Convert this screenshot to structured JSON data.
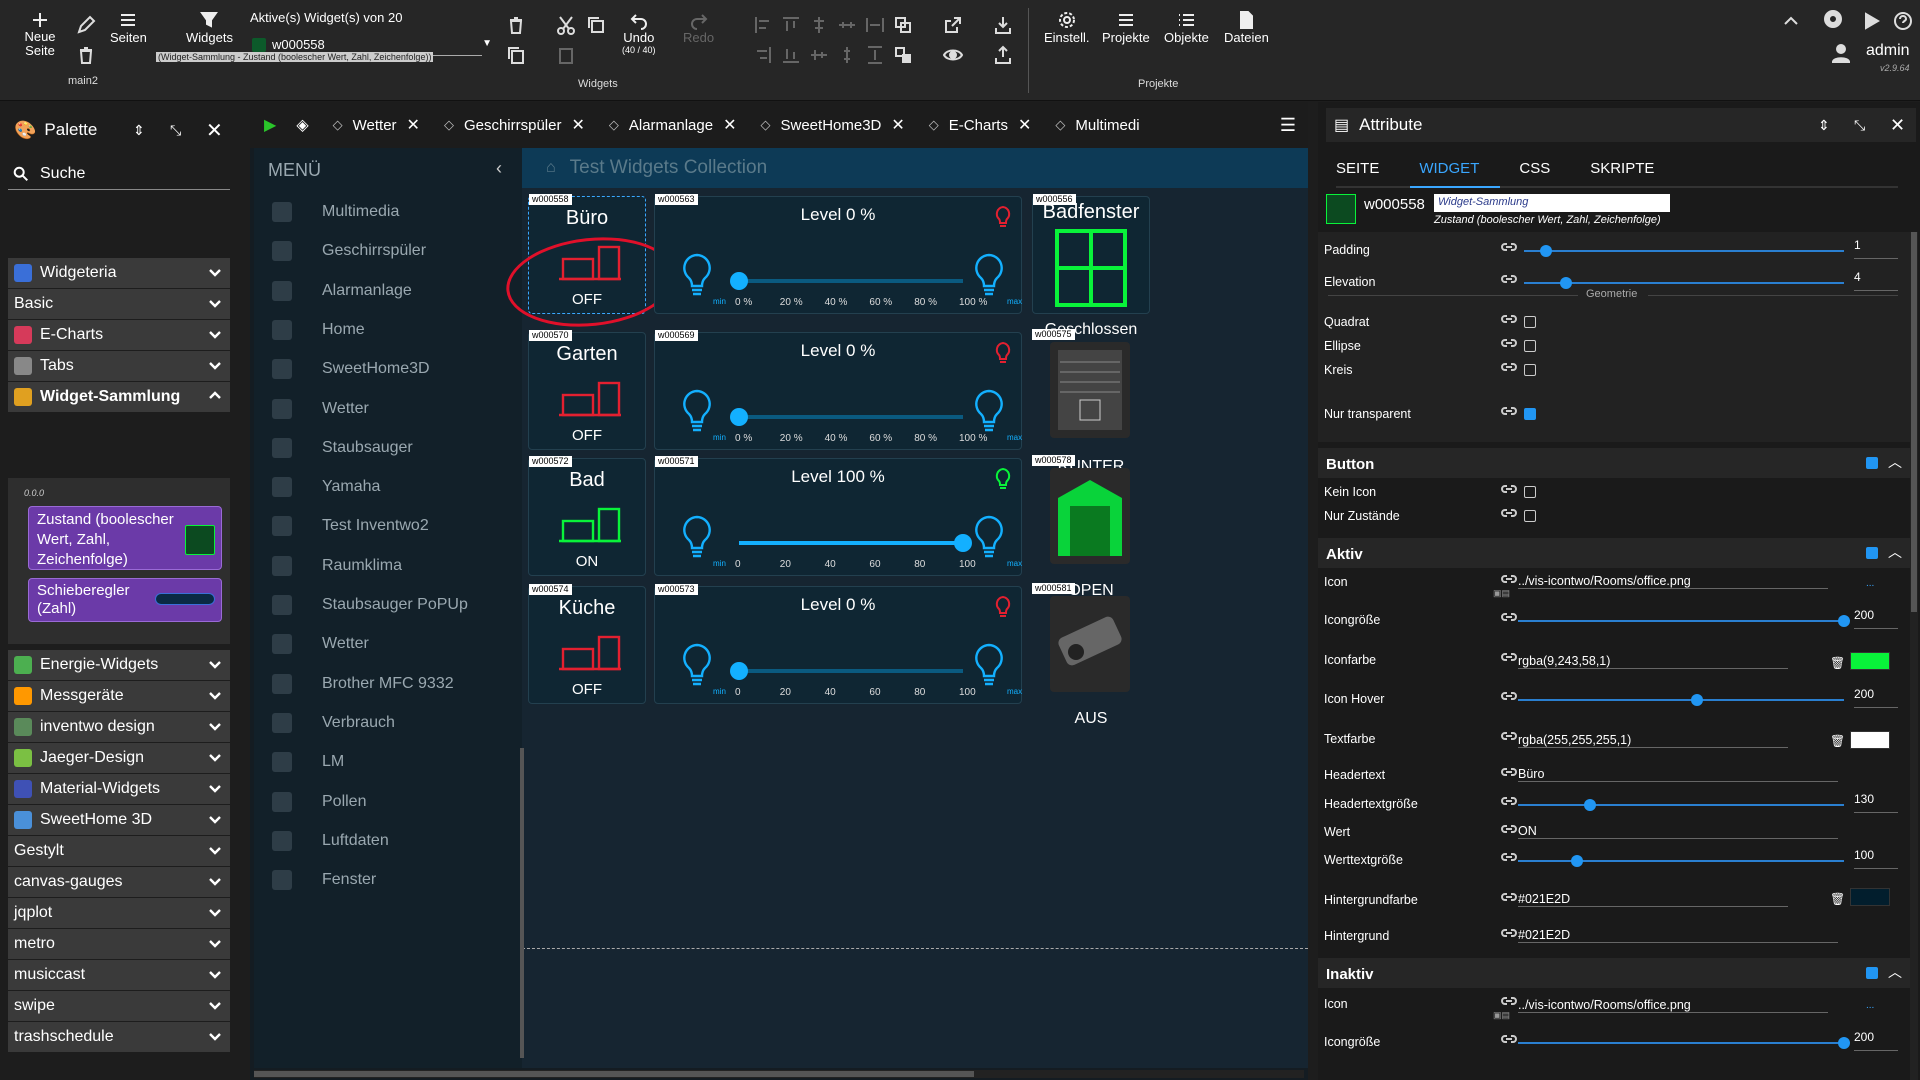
{
  "toolbar": {
    "new_page": "Neue\nSeite",
    "pages": "Seiten",
    "widgets": "Widgets",
    "project_name": "main2",
    "active_widgets": "Aktive(s) Widget(s) von 20",
    "selected_widget": "w000558",
    "widget_tooltip": "(Widget-Sammlung - Zustand (boolescher Wert, Zahl, Zeichenfolge))",
    "undo": "Undo",
    "undo_count": "(40 / 40)",
    "redo": "Redo",
    "group_widgets": "Widgets",
    "settings": "Einstell.",
    "projects": "Projekte",
    "objects": "Objekte",
    "files": "Dateien",
    "group_projects": "Projekte",
    "user": "admin",
    "version": "v2.9.64"
  },
  "palette": {
    "title": "Palette",
    "search": "Suche",
    "categories": [
      {
        "label": "Widgeteria",
        "color": "#3a6fd8"
      },
      {
        "label": "Basic",
        "color": ""
      },
      {
        "label": "E-Charts",
        "color": "#d63a5a"
      },
      {
        "label": "Tabs",
        "color": "#888888"
      },
      {
        "label": "Widget-Sammlung",
        "color": "#e0a020"
      }
    ],
    "version_label": "0.0.0",
    "widget_items": [
      {
        "label": "Zustand (boolescher Wert, Zahl, Zeichenfolge)"
      },
      {
        "label": "Schieberegler (Zahl)"
      }
    ],
    "categories_more": [
      {
        "label": "Energie-Widgets",
        "color": "#4caf50"
      },
      {
        "label": "Messgeräte",
        "color": "#ff9800"
      },
      {
        "label": "inventwo design",
        "color": "#5a8a5a"
      },
      {
        "label": "Jaeger-Design",
        "color": "#7bc043"
      },
      {
        "label": "Material-Widgets",
        "color": "#3f51b5"
      },
      {
        "label": "SweetHome 3D",
        "color": "#4a90d9"
      },
      {
        "label": "Gestylt",
        "color": ""
      },
      {
        "label": "canvas-gauges",
        "color": ""
      },
      {
        "label": "jqplot",
        "color": ""
      },
      {
        "label": "metro",
        "color": ""
      },
      {
        "label": "musiccast",
        "color": ""
      },
      {
        "label": "swipe",
        "color": ""
      },
      {
        "label": "trashschedule",
        "color": ""
      }
    ]
  },
  "tabs": [
    {
      "label": "Wetter"
    },
    {
      "label": "Geschirrspüler"
    },
    {
      "label": "Alarmanlage"
    },
    {
      "label": "SweetHome3D"
    },
    {
      "label": "E-Charts"
    },
    {
      "label": "Multimedi"
    }
  ],
  "menu": {
    "title": "MENÜ",
    "items": [
      "Multimedia",
      "Geschirrspüler",
      "Alarmanlage",
      "Home",
      "SweetHome3D",
      "Wetter",
      "Staubsauger",
      "Yamaha",
      "Test Inventwo2",
      "Raumklima",
      "Staubsauger PoPUp",
      "Wetter",
      "Brother MFC 9332",
      "Verbrauch",
      "LM",
      "Pollen",
      "Luftdaten",
      "Fenster"
    ]
  },
  "view": {
    "title": "Test Widgets Collection",
    "rooms": [
      {
        "id": "w000558",
        "name": "Büro",
        "value": "OFF",
        "icon_color": "#e32030"
      },
      {
        "id": "w000570",
        "name": "Garten",
        "value": "OFF",
        "icon_color": "#e32030"
      },
      {
        "id": "w000572",
        "name": "Bad",
        "value": "ON",
        "icon_color": "#09f33a"
      },
      {
        "id": "w000574",
        "name": "Küche",
        "value": "OFF",
        "icon_color": "#e32030"
      }
    ],
    "sliders": [
      {
        "id": "w000563",
        "label": "Level 0 %",
        "level": 0,
        "ticks": [
          "0 %",
          "20 %",
          "40 %",
          "60 %",
          "80 %",
          "100 %"
        ],
        "bulb": "#e32030"
      },
      {
        "id": "w000569",
        "label": "Level 0 %",
        "level": 0,
        "ticks": [
          "0 %",
          "20 %",
          "40 %",
          "60 %",
          "80 %",
          "100 %"
        ],
        "bulb": "#e32030"
      },
      {
        "id": "w000571",
        "label": "Level 100 %",
        "level": 100,
        "ticks": [
          "0",
          "20",
          "40",
          "60",
          "80",
          "100"
        ],
        "bulb": "#09f33a"
      },
      {
        "id": "w000573",
        "label": "Level 0 %",
        "level": 0,
        "ticks": [
          "0",
          "20",
          "40",
          "60",
          "80",
          "100"
        ],
        "bulb": "#e32030"
      }
    ],
    "min_label": "min",
    "max_label": "max",
    "devices": [
      {
        "id": "w000556",
        "name": "Badfenster",
        "value": "Geschlossen"
      },
      {
        "id": "w000575",
        "value": "RUNTER"
      },
      {
        "id": "w000578",
        "value": "OPEN"
      },
      {
        "id": "w000581",
        "value": "AUS"
      }
    ]
  },
  "attributes": {
    "title": "Attribute",
    "tabs": [
      "SEITE",
      "WIDGET",
      "CSS",
      "SKRIPTE"
    ],
    "widget_id": "w000558",
    "widget_set": "Widget-Sammlung",
    "widget_type": "Zustand (boolescher Wert, Zahl, Zeichenfolge)",
    "padding_label": "Padding",
    "padding_value": "1",
    "elevation_label": "Elevation",
    "elevation_value": "4",
    "geometry_label": "Geometrie",
    "quadrat": "Quadrat",
    "ellipse": "Ellipse",
    "kreis": "Kreis",
    "nur_transparent": "Nur transparent",
    "button_section": "Button",
    "kein_icon": "Kein Icon",
    "nur_zustaende": "Nur Zustände",
    "aktiv_section": "Aktiv",
    "icon_label": "Icon",
    "icon_value": "../vis-icontwo/Rooms/office.png",
    "icongroesse_label": "Icongröße",
    "icongroesse_value": "200",
    "iconfarbe_label": "Iconfarbe",
    "iconfarbe_value": "rgba(9,243,58,1)",
    "iconhover_label": "Icon Hover",
    "iconhover_value": "200",
    "textfarbe_label": "Textfarbe",
    "textfarbe_value": "rgba(255,255,255,1)",
    "headertext_label": "Headertext",
    "headertext_value": "Büro",
    "headertextgroesse_label": "Headertextgröße",
    "headertextgroesse_value": "130",
    "wert_label": "Wert",
    "wert_value": "ON",
    "werttextgroesse_label": "Werttextgröße",
    "werttextgroesse_value": "100",
    "hgfarbe_label": "Hintergrundfarbe",
    "hgfarbe_value": "#021E2D",
    "hg_label": "Hintergrund",
    "hg_value": "#021E2D",
    "inaktiv_section": "Inaktiv",
    "icon2_label": "Icon",
    "icon2_value": "../vis-icontwo/Rooms/office.png",
    "icongroesse2_label": "Icongröße",
    "icongroesse2_value": "200",
    "colors": {
      "accent": "#2196f3",
      "green": "#09f33a",
      "red": "#e32030"
    }
  }
}
